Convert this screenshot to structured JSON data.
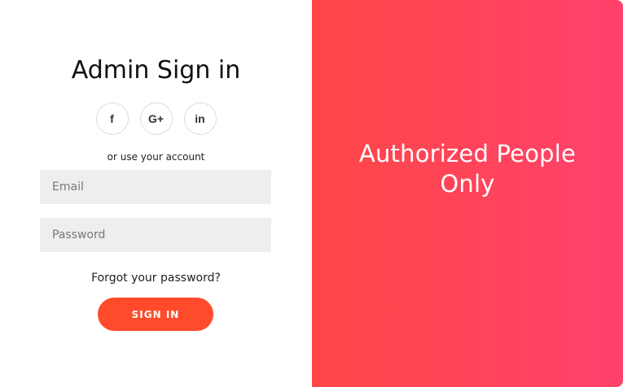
{
  "login": {
    "title": "Admin Sign in",
    "helper": "or use your account",
    "email_placeholder": "Email",
    "password_placeholder": "Password",
    "forgot_label": "Forgot your password?",
    "sign_in_label": "SIGN IN"
  },
  "socials": [
    {
      "label": "f",
      "icon": "facebook-icon"
    },
    {
      "label": "G+",
      "icon": "google-plus-icon"
    },
    {
      "label": "in",
      "icon": "linkedin-icon"
    }
  ],
  "overlay": {
    "title": "Authorized People Only"
  },
  "colors": {
    "accent": "#ff4b2b",
    "gradient_start": "#ff4747",
    "gradient_end": "#ff416c",
    "input_background": "#eeeeee"
  }
}
